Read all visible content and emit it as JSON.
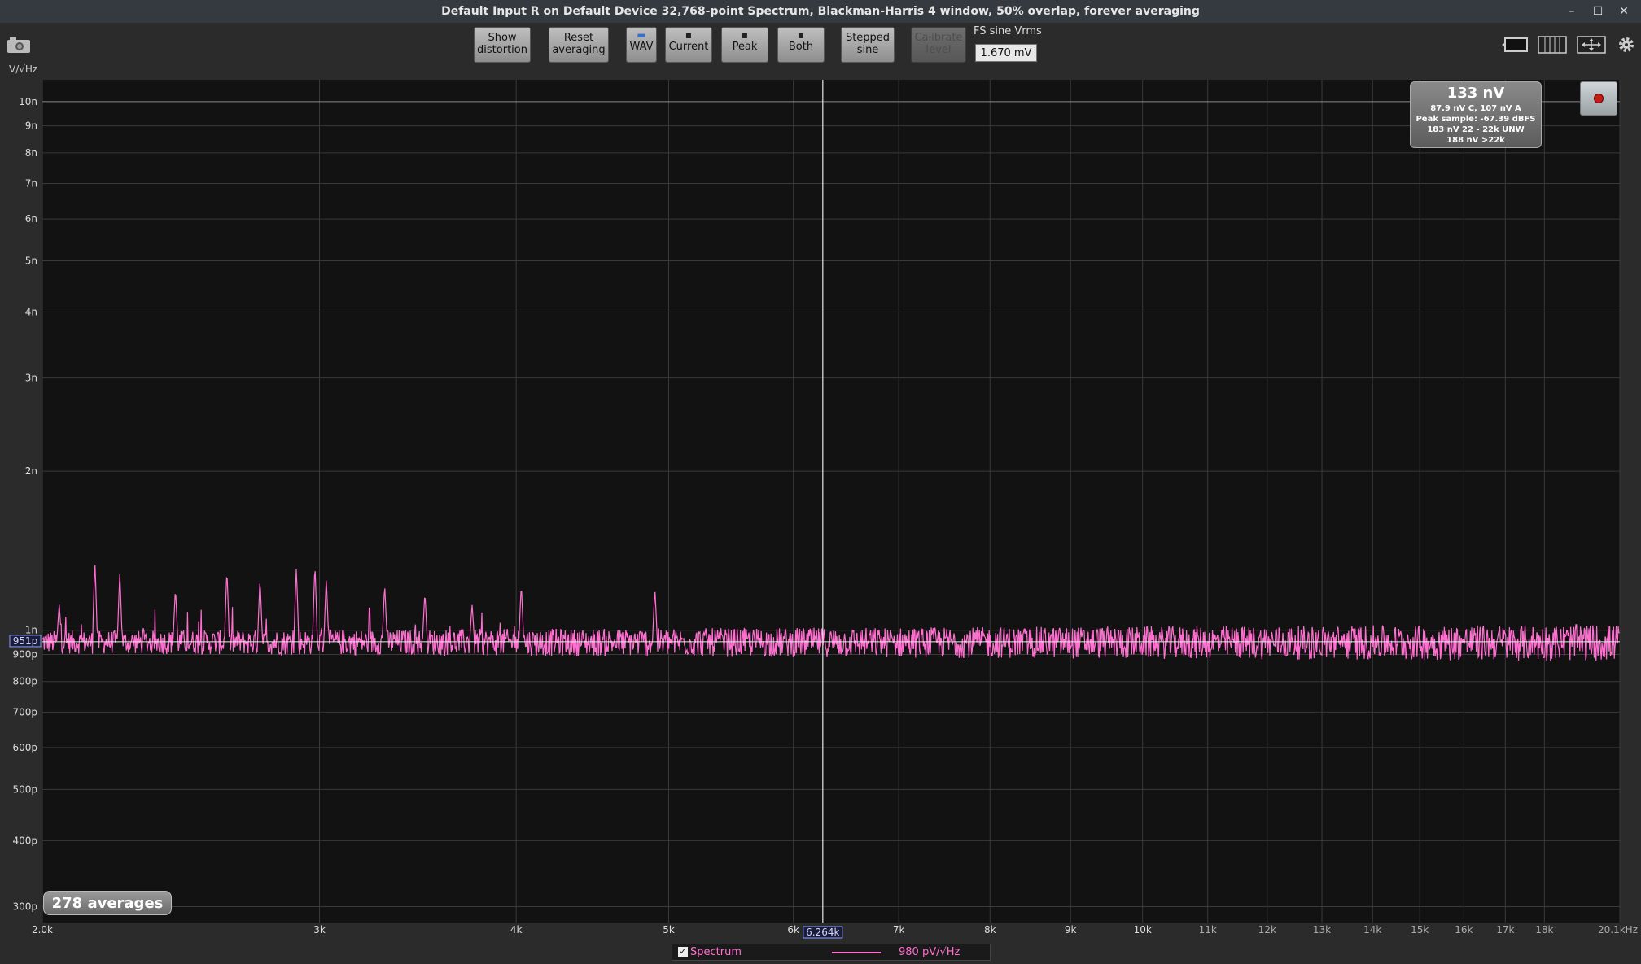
{
  "window": {
    "title": "Default Input R on Default Device 32,768-point Spectrum, Blackman-Harris 4 window, 50% overlap, forever averaging",
    "minimize": "–",
    "maximize": "☐",
    "close": "✕"
  },
  "toolbar": {
    "show_distortion": "Show\ndistortion",
    "reset_averaging": "Reset\naveraging",
    "wav": "WAV",
    "current": "Current",
    "peak": "Peak",
    "both": "Both",
    "stepped_sine": "Stepped\nsine",
    "calibrate_level": "Calibrate\nlevel",
    "fs_label": "FS sine Vrms",
    "fs_value": "1.670 mV",
    "save_icon": "floppy-icon",
    "folder_icon": "folder-icon"
  },
  "units_label": "V/√Hz",
  "summary": {
    "main": "133 nV",
    "line1": "87.9 nV C, 107 nV A",
    "line2": "Peak sample: -67.39 dBFS",
    "line3": "183 nV 22 - 22k UNW",
    "line4": "188 nV >22k"
  },
  "averages": "278 averages",
  "legend": {
    "checked": "✓",
    "name": "Spectrum",
    "value": "980 pV/√Hz"
  },
  "cursor": {
    "x_readout": "6.264k",
    "y_readout": "951p"
  },
  "colors": {
    "trace": "#ff6fcf",
    "plot_bg": "#121212",
    "grid": "#3a3a3a"
  },
  "chart_data": {
    "type": "line",
    "xscale": "log",
    "yscale": "log",
    "xlim": [
      2000,
      20100
    ],
    "ylim": [
      2.8e-10,
      1.1e-08
    ],
    "grid": true,
    "xticks": [
      {
        "v": 2000,
        "label": "2.0k"
      },
      {
        "v": 3000,
        "label": "3k"
      },
      {
        "v": 4000,
        "label": "4k"
      },
      {
        "v": 5000,
        "label": "5k"
      },
      {
        "v": 6000,
        "label": "6k"
      },
      {
        "v": 7000,
        "label": "7k"
      },
      {
        "v": 8000,
        "label": "8k"
      },
      {
        "v": 9000,
        "label": "9k"
      },
      {
        "v": 10000,
        "label": "10k"
      },
      {
        "v": 11000,
        "label": "11k"
      },
      {
        "v": 12000,
        "label": "12k"
      },
      {
        "v": 13000,
        "label": "13k"
      },
      {
        "v": 14000,
        "label": "14k"
      },
      {
        "v": 15000,
        "label": "15k"
      },
      {
        "v": 16000,
        "label": "16k"
      },
      {
        "v": 17000,
        "label": "17k"
      },
      {
        "v": 18000,
        "label": "18k"
      },
      {
        "v": 20100,
        "label": "20.1kHz"
      }
    ],
    "yticks": [
      {
        "v": 1e-08,
        "label": "10n"
      },
      {
        "v": 9e-09,
        "label": "9n"
      },
      {
        "v": 8e-09,
        "label": "8n"
      },
      {
        "v": 7e-09,
        "label": "7n"
      },
      {
        "v": 6e-09,
        "label": "6n"
      },
      {
        "v": 5e-09,
        "label": "5n"
      },
      {
        "v": 4e-09,
        "label": "4n"
      },
      {
        "v": 3e-09,
        "label": "3n"
      },
      {
        "v": 2e-09,
        "label": "2n"
      },
      {
        "v": 1e-09,
        "label": "1n"
      },
      {
        "v": 9e-10,
        "label": "900p"
      },
      {
        "v": 8e-10,
        "label": "800p"
      },
      {
        "v": 7e-10,
        "label": "700p"
      },
      {
        "v": 6e-10,
        "label": "600p"
      },
      {
        "v": 5e-10,
        "label": "500p"
      },
      {
        "v": 4e-10,
        "label": "400p"
      },
      {
        "v": 3e-10,
        "label": "300p"
      }
    ],
    "cursor_x": 6264,
    "cursor_y": 9.51e-10,
    "series": [
      {
        "name": "Spectrum",
        "noise_floor": 9.5e-10,
        "peaks": [
          [
            2050,
            1.12e-09
          ],
          [
            2160,
            1.35e-09
          ],
          [
            2240,
            1.28e-09
          ],
          [
            2430,
            1.2e-09
          ],
          [
            2620,
            1.3e-09
          ],
          [
            2750,
            1.25e-09
          ],
          [
            2900,
            1.31e-09
          ],
          [
            2980,
            1.33e-09
          ],
          [
            3030,
            1.25e-09
          ],
          [
            3300,
            1.22e-09
          ],
          [
            3500,
            1.18e-09
          ],
          [
            3750,
            1.12e-09
          ],
          [
            4030,
            1.22e-09
          ],
          [
            4900,
            1.2e-09
          ]
        ]
      }
    ]
  }
}
